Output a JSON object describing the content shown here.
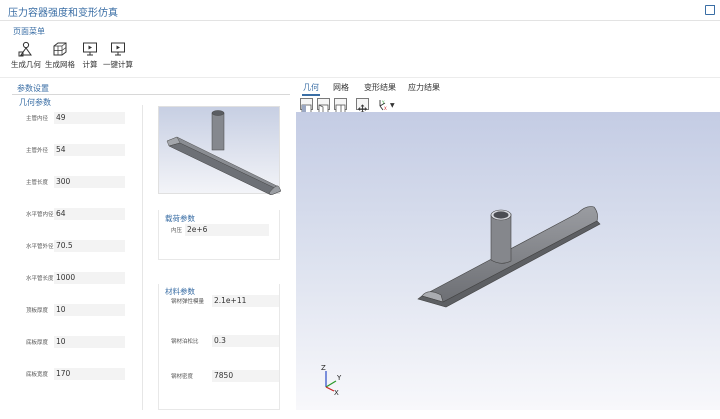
{
  "app": {
    "title": "压力容器强度和变形仿真"
  },
  "ribbon": {
    "group_label": "页面菜单",
    "tools": [
      {
        "label": "生成几何",
        "icon": "geometry-icon"
      },
      {
        "label": "生成网格",
        "icon": "mesh-icon"
      },
      {
        "label": "计算",
        "icon": "compute-icon"
      },
      {
        "label": "一键计算",
        "icon": "one-click-compute-icon"
      }
    ]
  },
  "settings": {
    "label": "参数设置",
    "geometry": {
      "label": "几何参数",
      "params": [
        {
          "label": "主管内径",
          "value": "49"
        },
        {
          "label": "主管外径",
          "value": "54"
        },
        {
          "label": "主管长度",
          "value": "300"
        },
        {
          "label": "水平管内径",
          "value": "64"
        },
        {
          "label": "水平管外径",
          "value": "70.5"
        },
        {
          "label": "水平管长度",
          "value": "1000"
        },
        {
          "label": "顶板厚度",
          "value": "10"
        },
        {
          "label": "底板厚度",
          "value": "10"
        },
        {
          "label": "底板宽度",
          "value": "170"
        }
      ]
    },
    "load": {
      "label": "载荷参数",
      "params": [
        {
          "label": "内压",
          "value": "2e+6"
        }
      ]
    },
    "material": {
      "label": "材料参数",
      "params": [
        {
          "label": "钢材弹性模量",
          "value": "2.1e+11"
        },
        {
          "label": "钢材泊松比",
          "value": "0.3"
        },
        {
          "label": "钢材密度",
          "value": "7850"
        }
      ]
    }
  },
  "viewer": {
    "tabs": [
      "几何",
      "网格",
      "变形结果",
      "应力结果"
    ],
    "active_tab": "几何",
    "axes": {
      "z": "Z",
      "y": "Y",
      "x": "X"
    },
    "triad_icon": {
      "y": "Y",
      "x": "X",
      "caret": "▼"
    }
  },
  "colors": {
    "accent": "#3a6ea5",
    "model": "#7c7f85"
  }
}
